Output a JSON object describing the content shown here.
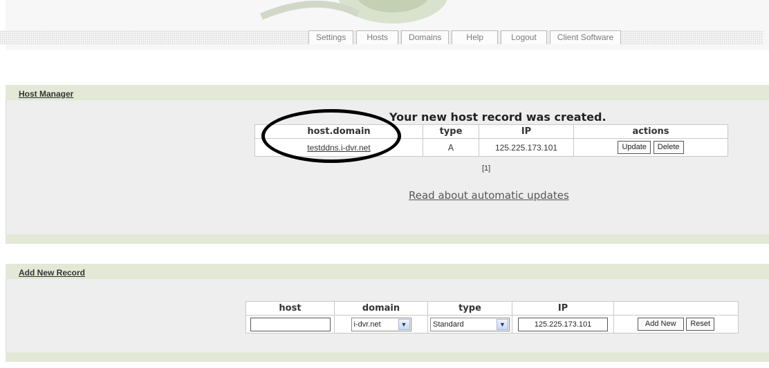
{
  "nav": {
    "tabs": [
      "Settings",
      "Hosts",
      "Domains",
      "Help",
      "Logout",
      "Client Software"
    ]
  },
  "host_manager": {
    "title": "Host Manager",
    "message": "Your new host record was created.",
    "columns": [
      "host.domain",
      "type",
      "IP",
      "actions"
    ],
    "row": {
      "host": "testddns.i-dvr.net",
      "type": "A",
      "ip": "125.225.173.101",
      "update_label": "Update",
      "delete_label": "Delete"
    },
    "pager": "[1]",
    "read_link": "Read about automatic updates"
  },
  "add_record": {
    "title": "Add New Record",
    "columns": [
      "host",
      "domain",
      "type",
      "IP"
    ],
    "host_value": "",
    "domain_value": "i-dvr.net",
    "type_value": "Standard",
    "ip_value": "125.225.173.101",
    "add_label": "Add New",
    "reset_label": "Reset"
  },
  "colors": {
    "section_bar": "#e8eddd",
    "panel": "#eeeeee",
    "annotation": "#000000"
  }
}
